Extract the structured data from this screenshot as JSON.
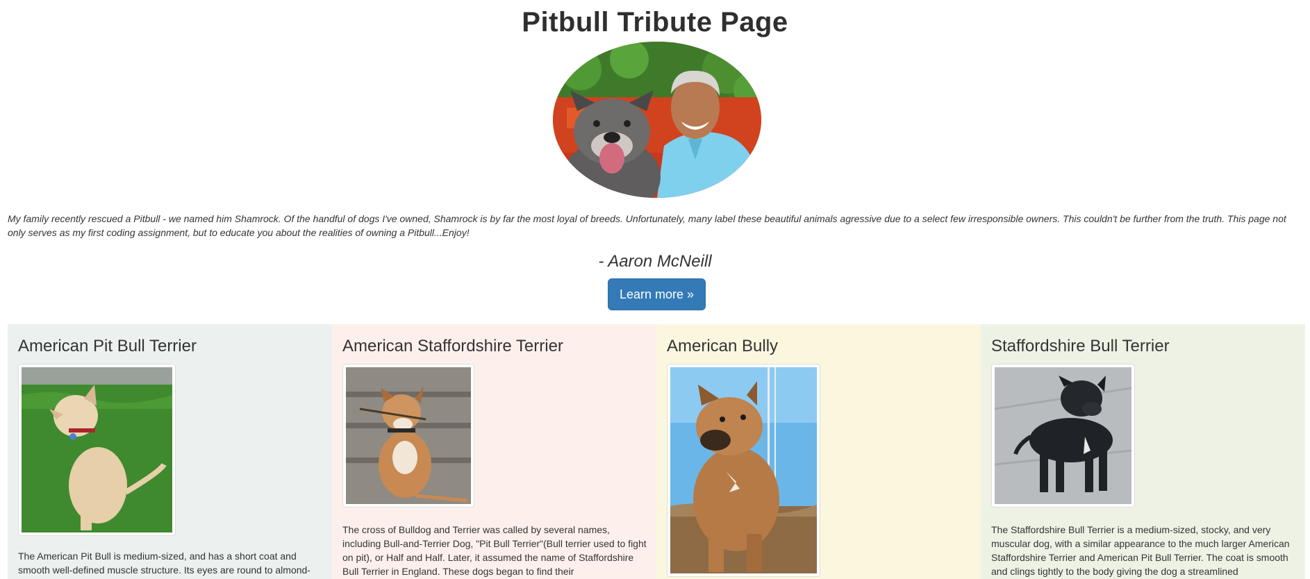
{
  "header": {
    "title": "Pitbull Tribute Page"
  },
  "intro": {
    "text": "My family recently rescued a Pitbull - we named him Shamrock. Of the handful of dogs I've owned, Shamrock is by far the most loyal of breeds. Unfortunately, many label these beautiful animals agressive due to a select few irresponsible owners. This couldn't be further from the truth. This page not only serves as my first coding assignment, but to educate you about the realities of owning a Pitbull...Enjoy!",
    "author": "- Aaron McNeill",
    "button_label": "Learn more »"
  },
  "breeds": [
    {
      "name": "American Pit Bull Terrier",
      "bg": "#ecf0ee",
      "description": "The American Pit Bull is medium-sized, and has a short coat and smooth well-defined muscle structure. Its eyes are round to almond-"
    },
    {
      "name": "American Staffordshire Terrier",
      "bg": "#fdf0ec",
      "description": "The cross of Bulldog and Terrier was called by several names, including Bull-and-Terrier Dog, \"Pit Bull Terrier\"(Bull terrier used to fight on pit), or Half and Half. Later, it assumed the name of Staffordshire Bull Terrier in England. These dogs began to find their"
    },
    {
      "name": "American Bully",
      "bg": "#fbf7df",
      "description": ""
    },
    {
      "name": "Staffordshire Bull Terrier",
      "bg": "#eef2e5",
      "description": "The Staffordshire Bull Terrier is a medium-sized, stocky, and very muscular dog, with a similar appearance to the much larger American Staffordshire Terrier and American Pit Bull Terrier. The coat is smooth and clings tightly to the body giving the dog a streamlined"
    }
  ]
}
